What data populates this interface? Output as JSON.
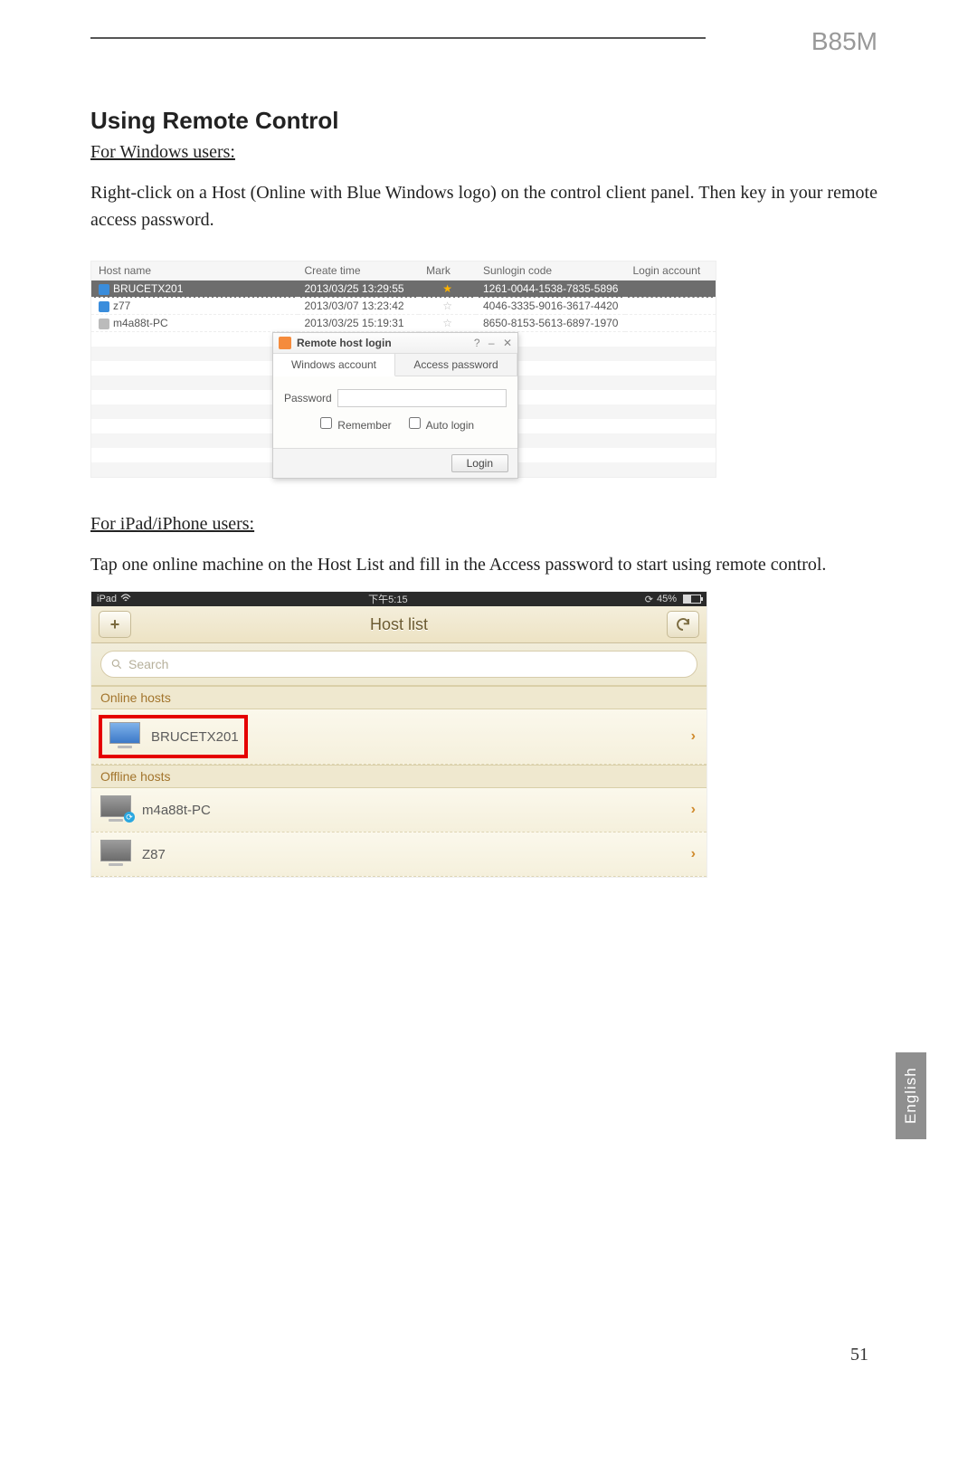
{
  "header": {
    "model": "B85M"
  },
  "section": {
    "title": "Using Remote Control",
    "windows_users_label": "For Windows users:",
    "windows_instructions": "Right-click on a Host (Online with Blue Windows logo) on the control client panel. Then key in your remote access password.",
    "ipad_users_label": "For iPad/iPhone users:",
    "ipad_instructions": "Tap one online machine on the Host List and fill in the Access password to start using remote control."
  },
  "win_screenshot": {
    "columns": {
      "host_name": "Host name",
      "create_time": "Create time",
      "mark": "Mark",
      "sunlogin_code": "Sunlogin code",
      "login_account": "Login account"
    },
    "rows": [
      {
        "host": "BRUCETX201",
        "time": "2013/03/25 13:29:55",
        "mark": "star",
        "code": "1261-0044-1538-7835-5896",
        "online": true,
        "selected": true
      },
      {
        "host": "z77",
        "time": "2013/03/07 13:23:42",
        "mark": "staroff",
        "code": "4046-3335-9016-3617-4420",
        "online": true,
        "selected": false
      },
      {
        "host": "m4a88t-PC",
        "time": "2013/03/25 15:19:31",
        "mark": "staroff",
        "code": "8650-8153-5613-6897-1970",
        "online": false,
        "selected": false
      }
    ],
    "dialog": {
      "title": "Remote host login",
      "tabs": {
        "windows_account": "Windows account",
        "access_password": "Access password"
      },
      "password_label": "Password",
      "remember_label": "Remember",
      "auto_login_label": "Auto login",
      "login_button": "Login"
    }
  },
  "ipad_screenshot": {
    "statusbar": {
      "device": "iPad",
      "time": "下午5:15",
      "battery_text": "45%"
    },
    "navbar": {
      "title": "Host list"
    },
    "search": {
      "placeholder": "Search"
    },
    "sections": {
      "online_header": "Online hosts",
      "offline_header": "Offline hosts"
    },
    "online_hosts": [
      {
        "name": "BRUCETX201"
      }
    ],
    "offline_hosts": [
      {
        "name": "m4a88t-PC"
      },
      {
        "name": "Z87"
      }
    ]
  },
  "footer": {
    "language": "English",
    "page_number": "51"
  }
}
